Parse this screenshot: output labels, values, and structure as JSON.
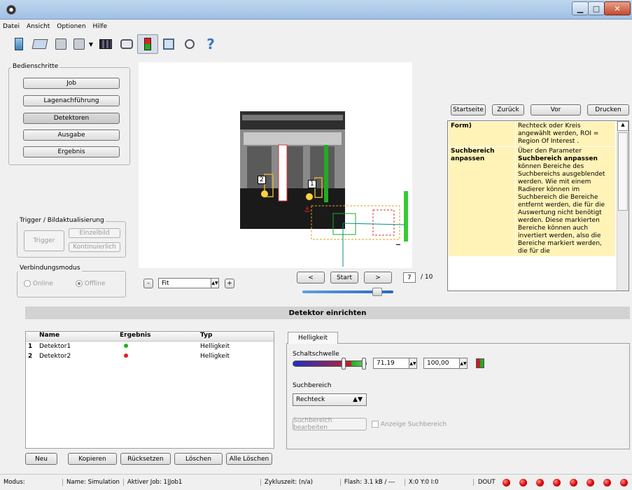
{
  "menu": [
    "Datei",
    "Ansicht",
    "Optionen",
    "Hilfe"
  ],
  "toolbar_icons": [
    "new-page-icon",
    "open-folder-icon",
    "save-icon",
    "save-as-icon",
    "dropdown-arrow-icon",
    "film-icon",
    "camera-icon",
    "sensor-flag-icon",
    "tab-icon",
    "zoom-icon",
    "help-icon"
  ],
  "steps": {
    "title": "Bedienschritte",
    "items": [
      "Job",
      "Lagenachführung",
      "Detektoren",
      "Ausgabe",
      "Ergebnis"
    ],
    "active": "Detektoren"
  },
  "trigger": {
    "title": "Trigger / Bildaktualisierung",
    "trigger": "Trigger",
    "single": "Einzelbild",
    "continuous": "Kontinuierlich"
  },
  "connection": {
    "title": "Verbindungsmodus",
    "online": "Online",
    "offline": "Offline",
    "selected": "Offline"
  },
  "zoom": {
    "minus": "-",
    "value": "Fit",
    "plus": "+"
  },
  "nav": {
    "prev": "<",
    "start": "Start",
    "next": ">",
    "current": "7",
    "total": "/ 10"
  },
  "markers": {
    "one": "1",
    "two": "2"
  },
  "help_nav": {
    "home": "Startseite",
    "back": "Zurück",
    "forward": "Vor",
    "print": "Drucken"
  },
  "help": {
    "r1k": "Form)",
    "r1v": "Rechteck oder Kreis angewählt werden, ROI = Region Of Interest .",
    "r2k": "Suchbereich anpassen",
    "r2v_a": "Über den Parameter ",
    "r2v_b": "Suchbereich anpassen",
    "r2v_c": " können Bereiche des Suchbereichs ausgeblendet werden. Wie mit einem Radierer können im Suchbereich die Bereiche entfernt werden, die für die Auswertung nicht benötigt werden. Diese markierten Bereiche können auch invertiert werden, also die Bereiche markiert werden, die für die"
  },
  "section": "Detektor einrichten",
  "table": {
    "headers": [
      "Name",
      "Ergebnis",
      "Typ"
    ],
    "rows": [
      {
        "n": "1",
        "name": "Detektor1",
        "result_color": "#22b022",
        "type": "Helligkeit"
      },
      {
        "n": "2",
        "name": "Detektor2",
        "result_color": "#e02020",
        "type": "Helligkeit"
      }
    ]
  },
  "list_buttons": [
    "Neu",
    "Kopieren",
    "Rücksetzen",
    "Löschen",
    "Alle Löschen"
  ],
  "tab": "Helligkeit",
  "threshold": {
    "label": "Schaltschwelle",
    "min": "71,19",
    "max": "100,00",
    "low_fraction": 0.84,
    "high_fraction": 1.0
  },
  "search": {
    "label": "Suchbereich",
    "shape": "Rechteck",
    "edit": "Suchbereich bearbeiten",
    "show": "Anzeige Suchbereich"
  },
  "status": {
    "modus": "Modus:",
    "name": "Name: Simulation",
    "job": "Aktiver Job:  1|Job1",
    "cycle": "Zykluszeit:  (n/a)",
    "flash": "Flash:  3.1 kB / ---",
    "xy": "X:0 Y:0 I:0",
    "dout": "DOUT",
    "led_count": 8
  },
  "colors": {
    "accent": "#d2d2d2",
    "help_bg": "#fff3b8",
    "led": "#d00000"
  }
}
